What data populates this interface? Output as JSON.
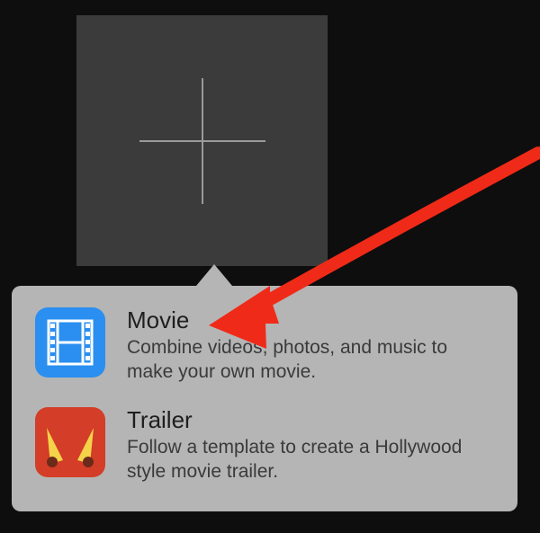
{
  "add_tile": {
    "icon_name": "plus-icon"
  },
  "menu": {
    "items": [
      {
        "icon_name": "film-icon",
        "title": "Movie",
        "description": "Combine videos, photos, and music to make your own movie."
      },
      {
        "icon_name": "trailer-icon",
        "title": "Trailer",
        "description": "Follow a template to create a Hollywood style movie trailer."
      }
    ]
  },
  "colors": {
    "movie_icon_bg": "#2a8ff0",
    "trailer_icon_bg": "#d43d27",
    "arrow": "#f02a18"
  }
}
